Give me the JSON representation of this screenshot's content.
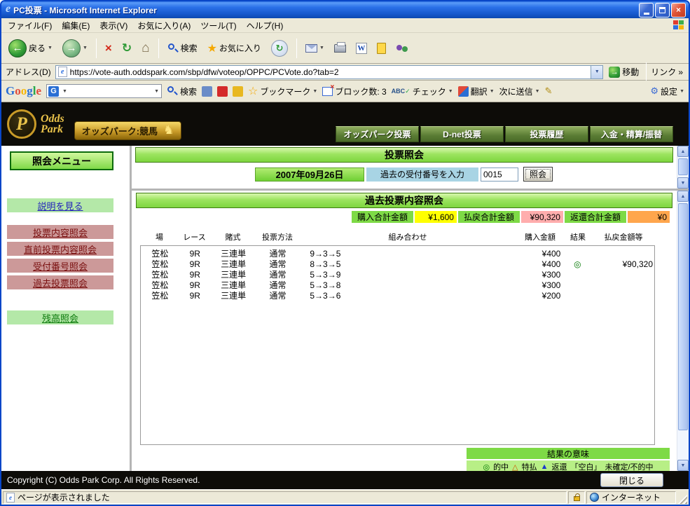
{
  "window": {
    "title": "PC投票 - Microsoft Internet Explorer"
  },
  "menu_bar": {
    "items": [
      "ファイル(F)",
      "編集(E)",
      "表示(V)",
      "お気に入り(A)",
      "ツール(T)",
      "ヘルプ(H)"
    ]
  },
  "toolbar": {
    "back_label": "戻る",
    "search_label": "検索",
    "favorites_label": "お気に入り"
  },
  "address_bar": {
    "label": "アドレス(D)",
    "url": "https://vote-auth.oddspark.com/sbp/dfw/voteop/OPPC/PCVote.do?tab=2",
    "go_label": "移動",
    "links_label": "リンク"
  },
  "google_bar": {
    "logo_letters": [
      "G",
      "o",
      "o",
      "g",
      "l",
      "e"
    ],
    "combo_letter": "G",
    "search_label": "検索",
    "bookmark_label": "ブックマーク",
    "block_label": "ブロック数: 3",
    "abc_label": "ABC",
    "check_label": "チェック",
    "translate_label": "翻訳",
    "send_label": "次に送信",
    "settings_label": "設定"
  },
  "banner": {
    "logo_letter": "P",
    "brand1": "Odds",
    "brand2": "Park",
    "keiba_label": "オッズパーク:競馬",
    "nav": [
      {
        "label": "オッズパーク投票"
      },
      {
        "label": "D-net投票"
      },
      {
        "label": "投票履歴"
      },
      {
        "label": "入金・精算/振替"
      }
    ]
  },
  "sidebar": {
    "menu_title": "照会メニュー",
    "items": [
      {
        "label": "説明を見る"
      },
      {
        "label": "投票内容照会"
      },
      {
        "label": "直前投票内容照会"
      },
      {
        "label": "受付番号照会"
      },
      {
        "label": "過去投票照会"
      },
      {
        "label": "残高照会"
      }
    ]
  },
  "vote_inquiry": {
    "title": "投票照会",
    "date": "2007年09月26日",
    "receipt_label": "過去の受付番号を入力",
    "receipt_value": "0015",
    "submit_label": "照会"
  },
  "past_votes": {
    "title": "過去投票内容照会",
    "summary": [
      {
        "label": "購入合計金額",
        "value": "¥1,600"
      },
      {
        "label": "払戻合計金額",
        "value": "¥90,320"
      },
      {
        "label": "返還合計金額",
        "value": "¥0"
      }
    ],
    "columns": [
      "場",
      "レース",
      "賭式",
      "投票方法",
      "組み合わせ",
      "購入金額",
      "結果",
      "払戻金額等"
    ],
    "rows": [
      {
        "place": "笠松",
        "race": "9R",
        "type": "三連単",
        "method": "通常",
        "combo": "9→3→5",
        "amount": "¥400",
        "result": "",
        "payout": ""
      },
      {
        "place": "笠松",
        "race": "9R",
        "type": "三連単",
        "method": "通常",
        "combo": "8→3→5",
        "amount": "¥400",
        "result": "◎",
        "payout": "¥90,320"
      },
      {
        "place": "笠松",
        "race": "9R",
        "type": "三連単",
        "method": "通常",
        "combo": "5→3→9",
        "amount": "¥300",
        "result": "",
        "payout": ""
      },
      {
        "place": "笠松",
        "race": "9R",
        "type": "三連単",
        "method": "通常",
        "combo": "5→3→8",
        "amount": "¥300",
        "result": "",
        "payout": ""
      },
      {
        "place": "笠松",
        "race": "9R",
        "type": "三連単",
        "method": "通常",
        "combo": "5→3→6",
        "amount": "¥200",
        "result": "",
        "payout": ""
      }
    ],
    "legend_title": "結果の意味",
    "legend_items": [
      {
        "symbol": "◎",
        "label": "的中"
      },
      {
        "symbol": "△",
        "label": "特払"
      },
      {
        "symbol": "▲",
        "label": "返還"
      },
      {
        "symbol": "「空白」",
        "label": "未確定/不的中"
      }
    ]
  },
  "footer": {
    "copyright": "Copyright (C) Odds Park Corp. All Rights Reserved.",
    "close_label": "閉じる"
  },
  "status_bar": {
    "text": "ページが表示されました",
    "zone": "インターネット"
  },
  "icons": {
    "ie_logo": "e",
    "close": "×",
    "back": "←",
    "forward": "→",
    "stop": "×",
    "refresh": "↻",
    "home": "⌂",
    "star": "★",
    "star_outline": "☆",
    "dropdown": "▼",
    "up": "▲",
    "down": "▼",
    "go": "→",
    "chevrons": "»",
    "word_letter": "W",
    "check": "✓",
    "pencil": "✎",
    "gear": "⚙",
    "horse": "♞"
  }
}
